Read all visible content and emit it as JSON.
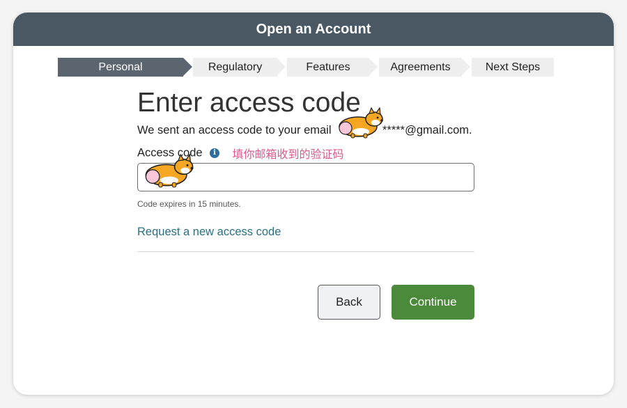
{
  "header": {
    "title": "Open an Account"
  },
  "stepper": {
    "steps": [
      {
        "label": "Personal",
        "active": true
      },
      {
        "label": "Regulatory",
        "active": false
      },
      {
        "label": "Features",
        "active": false
      },
      {
        "label": "Agreements",
        "active": false
      },
      {
        "label": "Next Steps",
        "active": false
      }
    ]
  },
  "main": {
    "title": "Enter access code",
    "sent_text": "We sent an access code to your email",
    "masked_email": "*****@gmail.com.",
    "field_label": "Access code",
    "info_icon": "info-icon",
    "annotation": "填你邮箱收到的验证码",
    "code_value": "",
    "hint": "Code expires in 15 minutes.",
    "request_link": "Request a new access code"
  },
  "actions": {
    "back_label": "Back",
    "continue_label": "Continue"
  },
  "colors": {
    "header_bg": "#4a5864",
    "active_step": "#5a6570",
    "link": "#2a6f80",
    "continue_bg": "#4a8a3a",
    "annotation": "#e0578a",
    "info_icon": "#2f6d9e"
  }
}
